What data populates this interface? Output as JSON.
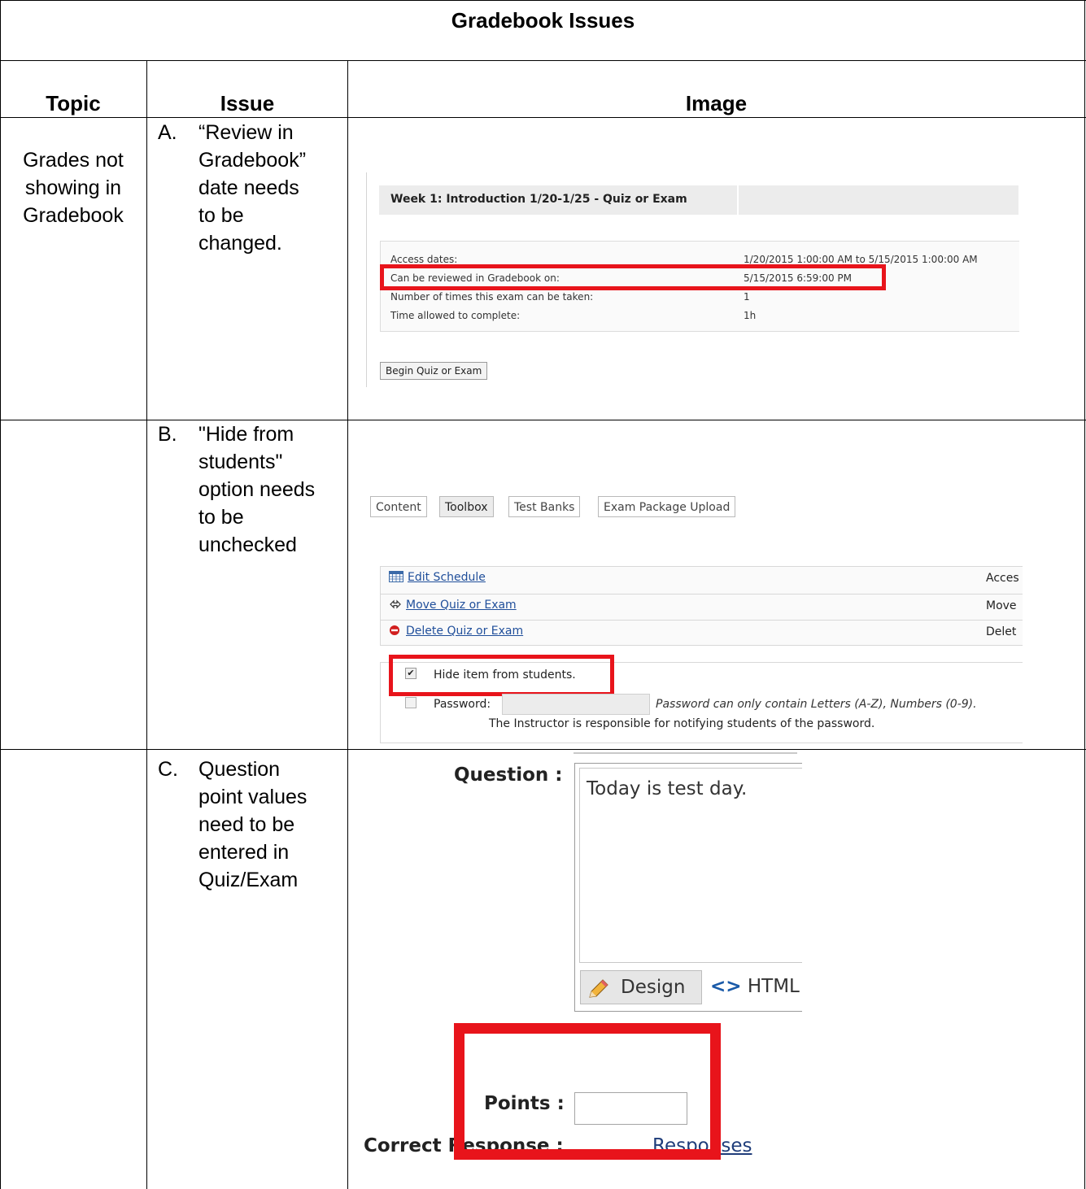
{
  "title": "Gradebook Issues",
  "headers": {
    "topic": "Topic",
    "issue": "Issue",
    "image": "Image"
  },
  "topic": [
    "Grades not",
    "showing in",
    "Gradebook"
  ],
  "issues": [
    {
      "marker": "A.",
      "lines": [
        "“Review in",
        "Gradebook”",
        "date needs",
        "to be",
        "changed."
      ]
    },
    {
      "marker": "B.",
      "lines": [
        "\"Hide from",
        "students\"",
        "option needs",
        "to be",
        "unchecked"
      ]
    },
    {
      "marker": "C.",
      "lines": [
        "Question",
        "point values",
        "need to be",
        "entered in",
        "Quiz/Exam"
      ]
    }
  ],
  "shot_a": {
    "heading": "Week 1: Introduction 1/20-1/25 - Quiz or Exam",
    "rows": [
      {
        "label": "Access dates:",
        "value": "1/20/2015 1:00:00 AM to 5/15/2015 1:00:00 AM"
      },
      {
        "label": "Can be reviewed in Gradebook on:",
        "value": "5/15/2015 6:59:00 PM"
      },
      {
        "label": "Number of times this exam can be taken:",
        "value": "1"
      },
      {
        "label": "Time allowed to complete:",
        "value": "1h"
      }
    ],
    "button": "Begin Quiz or Exam"
  },
  "shot_b": {
    "tabs": [
      "Content",
      "Toolbox",
      "Test Banks",
      "Exam Package Upload"
    ],
    "active_tab": "Toolbox",
    "actions": [
      {
        "label": "Edit Schedule",
        "right": "Acces",
        "icon": "calendar-icon"
      },
      {
        "label": "Move Quiz or Exam",
        "right": "Move",
        "icon": "move-icon"
      },
      {
        "label": "Delete Quiz or Exam",
        "right": "Delet",
        "icon": "delete-icon"
      }
    ],
    "hide_label": "Hide item from students.",
    "hide_checked": true,
    "password_label": "Password:",
    "password_value": "",
    "password_hint": "Password can only contain Letters (A-Z), Numbers (0-9).",
    "instructor_note": "The Instructor is responsible for notifying students of the password.",
    "highlight_color": "#e8141b"
  },
  "shot_c": {
    "question_label": "Question :",
    "question_text": "Today is test day.",
    "design_tab": "Design",
    "html_tab": "HTML",
    "points_label": "Points :",
    "points_value": "",
    "correct_label": "Correct Response :",
    "responses_link": "Responses"
  }
}
